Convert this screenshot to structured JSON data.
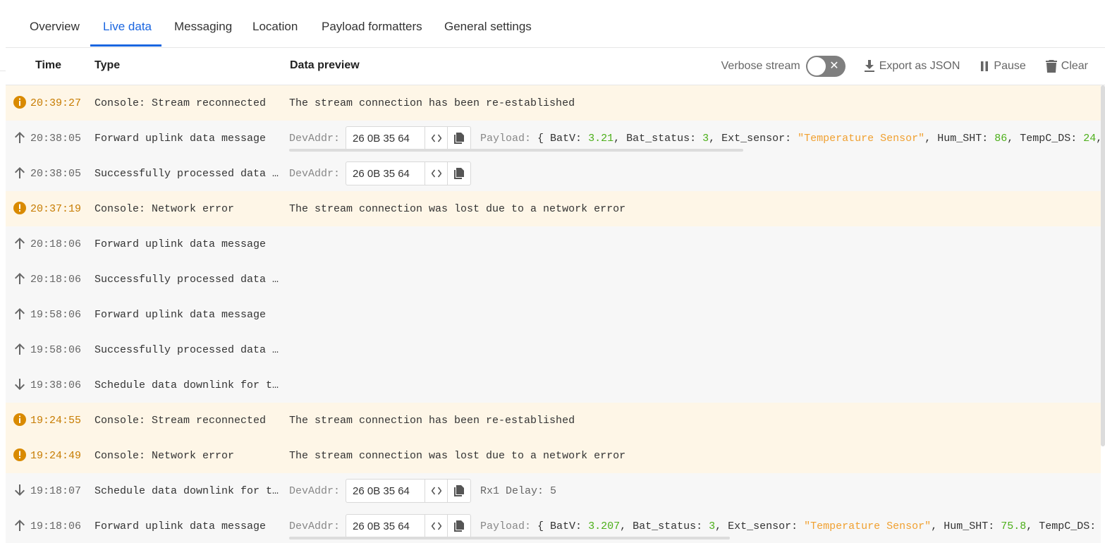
{
  "tabs": [
    {
      "label": "Overview"
    },
    {
      "label": "Live data"
    },
    {
      "label": "Messaging"
    },
    {
      "label": "Location"
    },
    {
      "label": "Payload formatters"
    },
    {
      "label": "General settings"
    }
  ],
  "active_tab": "Live data",
  "table": {
    "headers": {
      "time": "Time",
      "type": "Type",
      "preview": "Data preview"
    },
    "controls": {
      "verbose_label": "Verbose stream",
      "verbose_enabled": false,
      "export_label": "Export as JSON",
      "pause_label": "Pause",
      "clear_label": "Clear"
    }
  },
  "colors": {
    "accent": "#1a66e0",
    "warning": "#d98a00",
    "number": "#4caf1a",
    "string": "#f0a030"
  },
  "devaddr_label": "DevAddr:",
  "payload_label": "Payload:",
  "rows": [
    {
      "kind": "warn",
      "icon": "info-icon",
      "time": "20:39:27",
      "type": "Console: Stream reconnected",
      "preview": "The stream connection has been re-established"
    },
    {
      "kind": "up",
      "icon": "arrow-up-icon",
      "time": "20:38:05",
      "type": "Forward uplink data message",
      "devaddr": "26 0B 35 64",
      "payload": {
        "open": "{",
        "BatV": "3.21",
        "Bat_status": "3",
        "Ext_sensor": "\"Temperature Sensor\"",
        "Hum_SHT": "86",
        "TempC_DS": "24"
      }
    },
    {
      "kind": "up",
      "icon": "arrow-up-icon",
      "time": "20:38:05",
      "type": "Successfully processed data message",
      "devaddr": "26 0B 35 64"
    },
    {
      "kind": "warn",
      "icon": "error-icon",
      "time": "20:37:19",
      "type": "Console: Network error",
      "preview": "The stream connection was lost due to a network error"
    },
    {
      "kind": "up",
      "icon": "arrow-up-icon",
      "time": "20:18:06",
      "type": "Forward uplink data message"
    },
    {
      "kind": "up",
      "icon": "arrow-up-icon",
      "time": "20:18:06",
      "type": "Successfully processed data message"
    },
    {
      "kind": "up",
      "icon": "arrow-up-icon",
      "time": "19:58:06",
      "type": "Forward uplink data message"
    },
    {
      "kind": "up",
      "icon": "arrow-up-icon",
      "time": "19:58:06",
      "type": "Successfully processed data message"
    },
    {
      "kind": "down",
      "icon": "arrow-down-icon",
      "time": "19:38:06",
      "type": "Schedule data downlink for transmission"
    },
    {
      "kind": "warn",
      "icon": "info-icon",
      "time": "19:24:55",
      "type": "Console: Stream reconnected",
      "preview": "The stream connection has been re-established"
    },
    {
      "kind": "warn",
      "icon": "error-icon",
      "time": "19:24:49",
      "type": "Console: Network error",
      "preview": "The stream connection was lost due to a network error"
    },
    {
      "kind": "down",
      "icon": "arrow-down-icon",
      "time": "19:18:07",
      "type": "Schedule data downlink for transmission",
      "devaddr": "26 0B 35 64",
      "rx1": "Rx1 Delay: 5"
    },
    {
      "kind": "up",
      "icon": "arrow-up-icon",
      "time": "19:18:06",
      "type": "Forward uplink data message",
      "devaddr": "26 0B 35 64",
      "payload": {
        "open": "{",
        "BatV": "3.207",
        "Bat_status": "3",
        "Ext_sensor": "\"Temperature Sensor\"",
        "Hum_SHT": "75.8",
        "TempC_DS": ""
      }
    }
  ]
}
